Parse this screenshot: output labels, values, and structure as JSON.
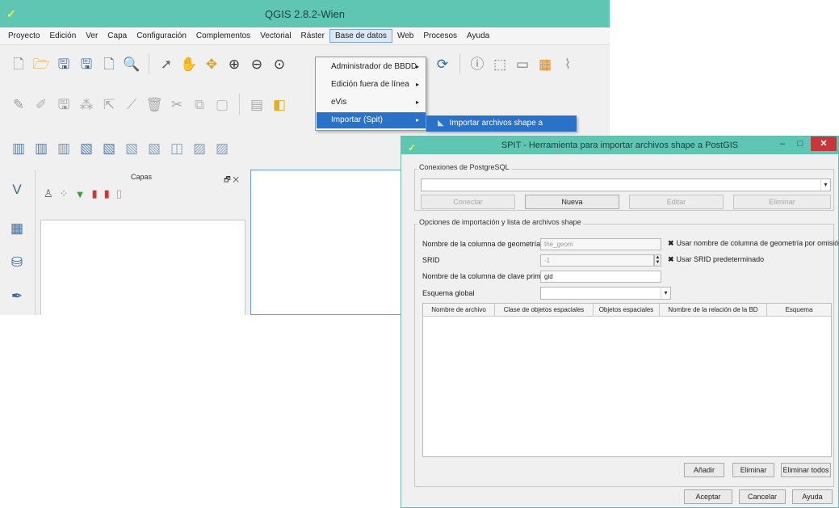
{
  "qgis": {
    "title": "QGIS 2.8.2-Wien",
    "logo_glyph": "✓",
    "menu": [
      "Proyecto",
      "Edición",
      "Ver",
      "Capa",
      "Configuración",
      "Complementos",
      "Vectorial",
      "Ráster",
      "Base de datos",
      "Web",
      "Procesos",
      "Ayuda"
    ],
    "active_menu_index": 8
  },
  "db_menu": {
    "items": [
      {
        "label": "Administrador de BBDD",
        "arrow": "▸"
      },
      {
        "label": "Edición fuera de línea",
        "arrow": "▸"
      },
      {
        "label": "eVis",
        "arrow": "▸"
      },
      {
        "label": "Importar (Spit)",
        "arrow": "▸"
      }
    ],
    "submenu_label": "Importar archivos shape a PostgreSQL"
  },
  "layers_panel": {
    "title": "Capas",
    "buttons": "🗗 ✕"
  },
  "spit": {
    "title": "SPIT - Herramienta para importar archivos shape a PostGIS",
    "minimize": "–",
    "maximize": "□",
    "close": "✕",
    "connections_group": "Conexiones de PostgreSQL",
    "connect_label": "Conectar",
    "new_label": "Nueva",
    "edit_label": "Editar",
    "delete_label": "Eliminar",
    "options_group": "Opciones de importación y lista de archivos shape",
    "geom_col_label": "Nombre de la columna de geometría",
    "geom_col_value": "the_geom",
    "use_default_geom_label": "Usar nombre de columna de geometría por omisión",
    "srid_label": "SRID",
    "srid_value": "-1",
    "use_default_srid_label": "Usar SRID predeterminado",
    "pk_label": "Nombre de la columna de clave primaria",
    "pk_value": "gid",
    "schema_label": "Esquema global",
    "columns": [
      "Nombre de archivo",
      "Clase de objetos espaciales",
      "Objetos espaciales",
      "Nombre de la relación de la BD",
      "Esquema"
    ],
    "add_label": "Añadir",
    "remove_label": "Eliminar",
    "remove_all_label": "Eliminar todos",
    "ok_label": "Aceptar",
    "cancel_label": "Cancelar",
    "help_label": "Ayuda"
  }
}
